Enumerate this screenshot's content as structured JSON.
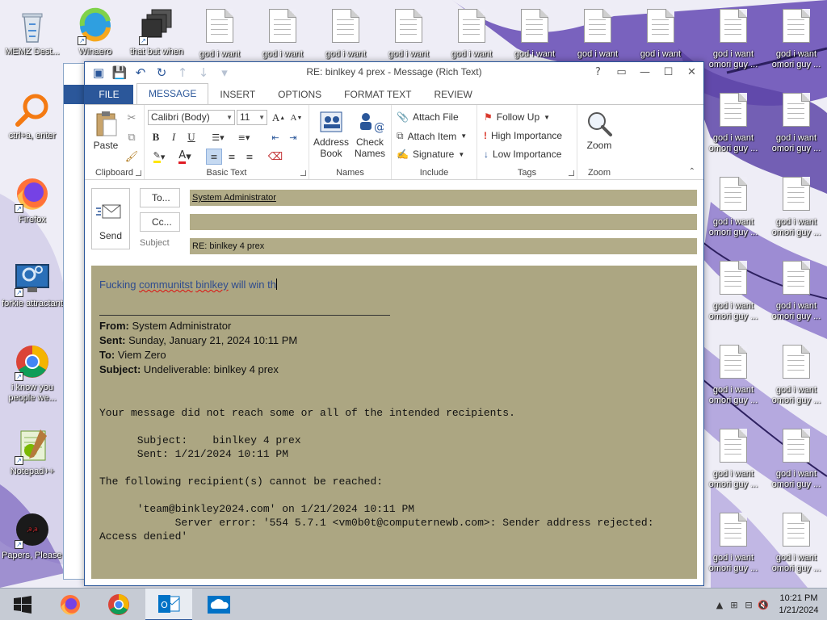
{
  "desktop": {
    "icons_left": [
      {
        "label": "MEMZ Dest...",
        "icon": "recycle-bin-icon"
      },
      {
        "label": "Winaero",
        "icon": "winaero-icon"
      },
      {
        "label": "that but when",
        "icon": "stacked-windows-icon"
      },
      {
        "label": "ctrl+a, enter",
        "icon": "magnifier-icon"
      },
      {
        "label": "Firefox",
        "icon": "firefox-icon"
      },
      {
        "label": "forkie attractant",
        "icon": "settings-monitor-icon"
      },
      {
        "label": "i know you people we...",
        "icon": "chrome-icon"
      },
      {
        "label": "Notepad++",
        "icon": "notepad-plus-plus-icon"
      },
      {
        "label": "Papers, Please Forz",
        "icon": "papers-please-icon"
      }
    ],
    "top_row_docs": [
      "god i want",
      "god i want",
      "god i want",
      "god i want",
      "god i want",
      "god i want",
      "god i want",
      "god i want"
    ],
    "right_col_docs": [
      "god i want omori guy ...",
      "god i want omori guy ..."
    ]
  },
  "window": {
    "title": "RE: binlkey 4 prex  - Message (Rich Text)",
    "controls": {
      "help": "?",
      "restore_ribbon": "▭",
      "minimize": "—",
      "maximize": "☐",
      "close": "✕"
    }
  },
  "tabs": [
    "FILE",
    "MESSAGE",
    "INSERT",
    "OPTIONS",
    "FORMAT TEXT",
    "REVIEW"
  ],
  "ribbon": {
    "clipboard": {
      "label": "Clipboard",
      "paste": "Paste"
    },
    "basic_text": {
      "label": "Basic Text",
      "font": "Calibri (Body)",
      "size": "11",
      "bold": "B",
      "italic": "I",
      "underline": "U"
    },
    "names": {
      "label": "Names",
      "address_book_1": "Address",
      "address_book_2": "Book",
      "check_names_1": "Check",
      "check_names_2": "Names"
    },
    "include": {
      "label": "Include",
      "attach_file": "Attach File",
      "attach_item": "Attach Item",
      "signature": "Signature"
    },
    "tags": {
      "label": "Tags",
      "follow_up": "Follow Up",
      "high": "High Importance",
      "low": "Low Importance"
    },
    "zoom": {
      "label": "Zoom",
      "zoom": "Zoom"
    }
  },
  "header": {
    "send": "Send",
    "to_btn": "To...",
    "cc_btn": "Cc...",
    "subject_label": "Subject",
    "to_value": "System Administrator",
    "cc_value": "",
    "subject_value": "RE: binlkey 4 prex"
  },
  "body": {
    "typed_a": "Fucking ",
    "typed_b": "communitst",
    "typed_c": " ",
    "typed_d": "binlkey",
    "typed_e": " will win th",
    "from_label": "From:",
    "from": " System Administrator",
    "sent_label": "Sent:",
    "sent": " Sunday, January 21, 2024 10:11 PM",
    "to_label": "To:",
    "to": " Viem Zero",
    "subject_label": "Subject:",
    "subject": " Undeliverable: binlkey 4 prex",
    "ndr_1": "Your message did not reach some or all of the intended recipients.",
    "ndr_2": "      Subject:    binlkey 4 prex",
    "ndr_3": "      Sent: 1/21/2024 10:11 PM",
    "ndr_4": "The following recipient(s) cannot be reached:",
    "ndr_5": "      'team@binkley2024.com' on 1/21/2024 10:11 PM",
    "ndr_6": "            Server error: '554 5.7.1 <vm0b0t@computernewb.com>: Sender address rejected:",
    "ndr_7": "Access denied'"
  },
  "taskbar": {
    "time": "10:21 PM",
    "date": "1/21/2024"
  }
}
